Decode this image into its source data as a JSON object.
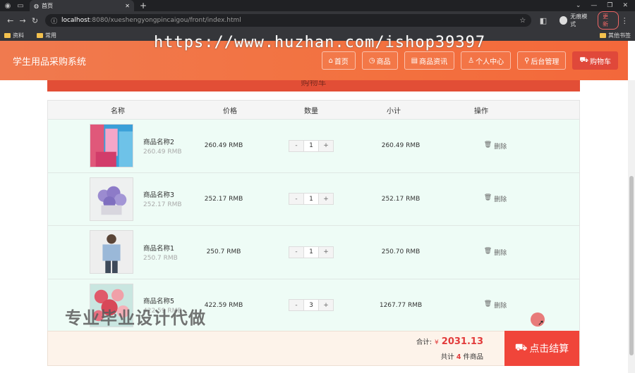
{
  "browser": {
    "tab_title": "首页",
    "url_host": "localhost",
    "url_path": ":8080/xueshengyongpincaigou/front/index.html",
    "incognito_label": "无痕模式",
    "update_label": "更新",
    "bookmarks": [
      "资料",
      "常用"
    ],
    "bookmarks_right": "其他书签"
  },
  "watermark": "https://www.huzhan.com/ishop39397",
  "header": {
    "site_title": "学生用品采购系统",
    "nav": [
      {
        "label": "首页",
        "icon": "home-icon"
      },
      {
        "label": "商品",
        "icon": "clock-icon"
      },
      {
        "label": "商品资讯",
        "icon": "news-icon"
      },
      {
        "label": "个人中心",
        "icon": "user-icon"
      },
      {
        "label": "后台管理",
        "icon": "link-icon"
      },
      {
        "label": "购物车",
        "icon": "cart-icon"
      }
    ]
  },
  "cart_title": "购物车",
  "table": {
    "headers": {
      "name": "名称",
      "price": "价格",
      "qty": "数量",
      "subtotal": "小计",
      "op": "操作"
    },
    "rows": [
      {
        "name": "商品名称2",
        "sub_price": "260.49 RMB",
        "price": "260.49 RMB",
        "qty": "1",
        "subtotal": "260.49 RMB",
        "delete": "删除"
      },
      {
        "name": "商品名称3",
        "sub_price": "252.17 RMB",
        "price": "252.17 RMB",
        "qty": "1",
        "subtotal": "252.17 RMB",
        "delete": "删除"
      },
      {
        "name": "商品名称1",
        "sub_price": "250.7 RMB",
        "price": "250.7 RMB",
        "qty": "1",
        "subtotal": "250.70 RMB",
        "delete": "删除"
      },
      {
        "name": "商品名称5",
        "sub_price": "422.59 RMB",
        "price": "422.59 RMB",
        "qty": "3",
        "subtotal": "1267.77 RMB",
        "delete": "删除"
      }
    ]
  },
  "stepper": {
    "minus": "-",
    "plus": "+"
  },
  "footer": {
    "total_label": "合计:",
    "currency": "¥",
    "total": "2031.13",
    "count_prefix": "共计",
    "count": "4",
    "count_suffix": "件商品",
    "checkout_label": "点击结算"
  },
  "overlay_text": "专业毕业设计代做"
}
